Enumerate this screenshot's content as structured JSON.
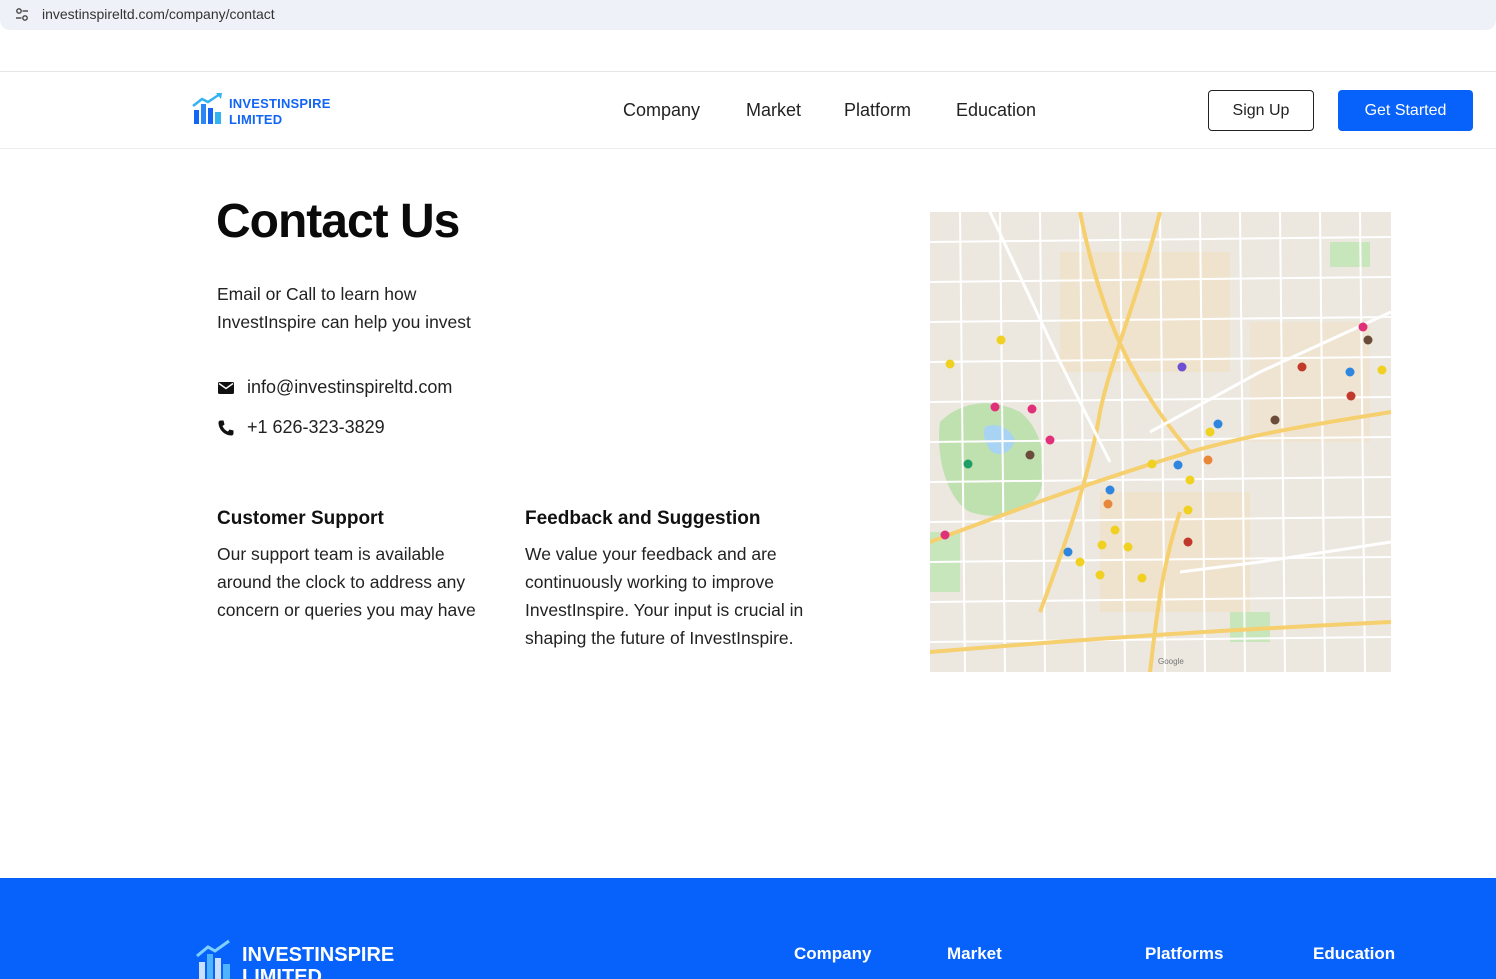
{
  "browser": {
    "url": "investinspireltd.com/company/contact",
    "site_info_icon": "tune-icon"
  },
  "header": {
    "logo_line1": "INVESTINSPIRE",
    "logo_line2": "LIMITED",
    "nav": [
      "Company",
      "Market",
      "Platform",
      "Education"
    ],
    "signup_label": "Sign Up",
    "get_started_label": "Get Started",
    "colors": {
      "brand": "#0762fb"
    }
  },
  "main": {
    "title": "Contact Us",
    "subtitle": "Email or Call to learn how InvestInspire can help you invest",
    "email": "info@investinspireltd.com",
    "phone": "+1 626-323-3829",
    "cards": [
      {
        "title": "Customer Support",
        "body": "Our support team is available around the clock to address any concern or queries you may have"
      },
      {
        "title": "Feedback and Suggestion",
        "body": "We value your feedback and are continuously working to improve InvestInspire. Your input is crucial in shaping the future of InvestInspire."
      }
    ],
    "map_attribution": "Google"
  },
  "footer": {
    "logo_line1": "INVESTINSPIRE",
    "logo_line2": "LIMITED",
    "columns": [
      "Company",
      "Market",
      "Platforms",
      "Education"
    ]
  }
}
